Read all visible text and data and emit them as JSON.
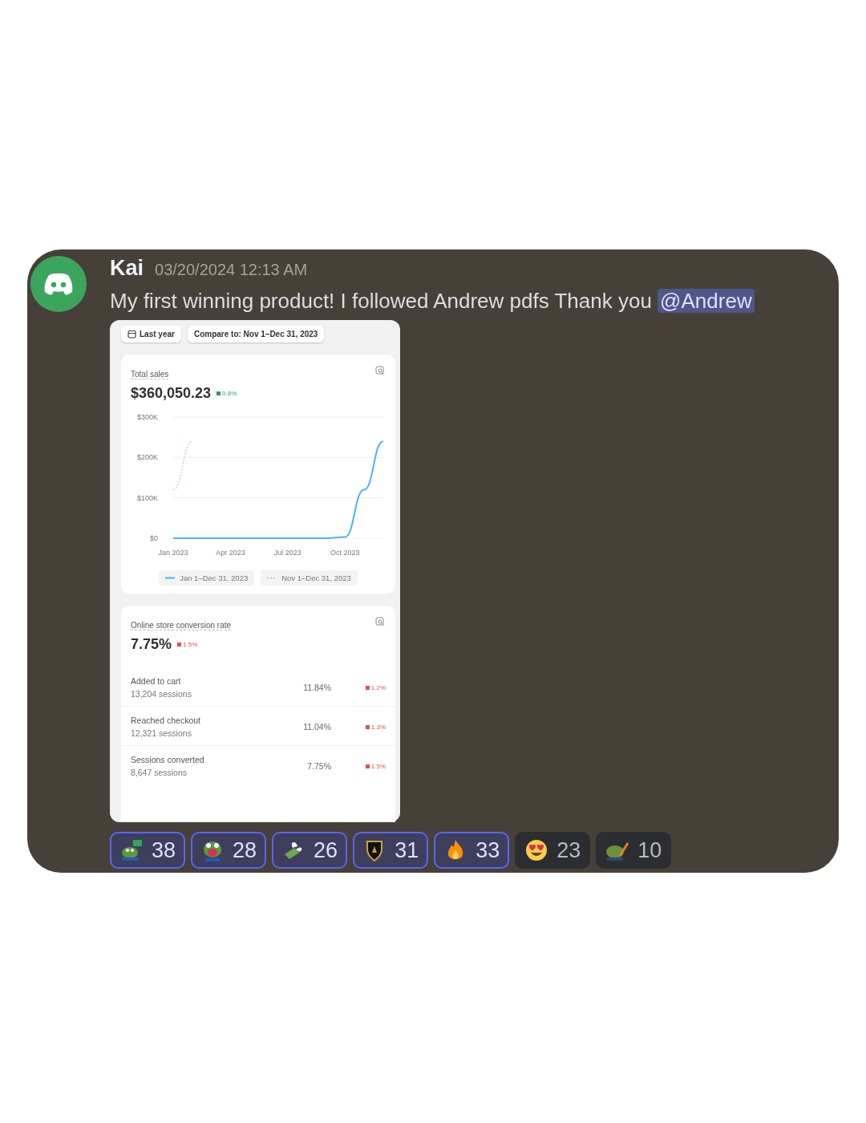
{
  "message": {
    "author": "Kai",
    "timestamp": "03/20/2024 12:13 AM",
    "text": "My first winning product! I followed Andrew pdfs Thank you",
    "mention": "@Andrew"
  },
  "attachment": {
    "date_buttons": [
      {
        "label": "Last year",
        "kind": "calendar"
      },
      {
        "label": "Compare to: Nov 1–Dec 31, 2023",
        "kind": "plain"
      }
    ],
    "sales_card": {
      "title": "Total sales",
      "value": "$360,050.23",
      "change": {
        "text": "0.8%",
        "kind": "up"
      },
      "chart_data": {
        "type": "line",
        "categories": [
          "Jan 2023",
          null,
          null,
          "Apr 2023",
          null,
          null,
          "Jul 2023",
          null,
          null,
          "Oct 2023",
          null,
          null
        ],
        "ylim": [
          0,
          300000
        ],
        "yticks": [
          {
            "value": 0,
            "label": "$0"
          },
          {
            "value": 100000,
            "label": "$100K"
          },
          {
            "value": 200000,
            "label": "$200K"
          },
          {
            "value": 300000,
            "label": "$300K"
          }
        ],
        "series": [
          {
            "name": "Jan 1–Dec 31, 2023",
            "color": "#4fb3e8",
            "line_style": "solid",
            "values": [
              0,
              0,
              0,
              0,
              0,
              0,
              0,
              0,
              0,
              3000,
              120000,
              240000
            ]
          },
          {
            "name": "Nov 1–Dec 31, 2023",
            "color": "#9fd3f0",
            "line_style": "dashed",
            "values": [
              120000,
              240000,
              null,
              null,
              null,
              null,
              null,
              null,
              null,
              null,
              null,
              null
            ]
          }
        ]
      }
    },
    "conversion_card": {
      "title": "Online store conversion rate",
      "value": "7.75%",
      "change": {
        "text": "1.5%",
        "kind": "down"
      },
      "rows": [
        {
          "label": "Added to cart",
          "sessions": "13,204 sessions",
          "rate": "11.84%",
          "change": {
            "text": "1.2%",
            "kind": "down"
          }
        },
        {
          "label": "Reached checkout",
          "sessions": "12,321 sessions",
          "rate": "11.04%",
          "change": {
            "text": "1.3%",
            "kind": "down"
          }
        },
        {
          "label": "Sessions converted",
          "sessions": "8,647 sessions",
          "rate": "7.75%",
          "change": {
            "text": "1.5%",
            "kind": "down"
          }
        }
      ]
    }
  },
  "reactions": [
    {
      "kind": "frog-yes",
      "count": "38",
      "selected": true
    },
    {
      "kind": "frog-scream",
      "count": "28",
      "selected": true
    },
    {
      "kind": "money",
      "count": "26",
      "selected": true
    },
    {
      "kind": "shield",
      "count": "31",
      "selected": true
    },
    {
      "kind": "fire",
      "count": "33",
      "selected": true
    },
    {
      "kind": "heart-eyes",
      "count": "23",
      "selected": false
    },
    {
      "kind": "frog-pen",
      "count": "10",
      "selected": false
    }
  ]
}
